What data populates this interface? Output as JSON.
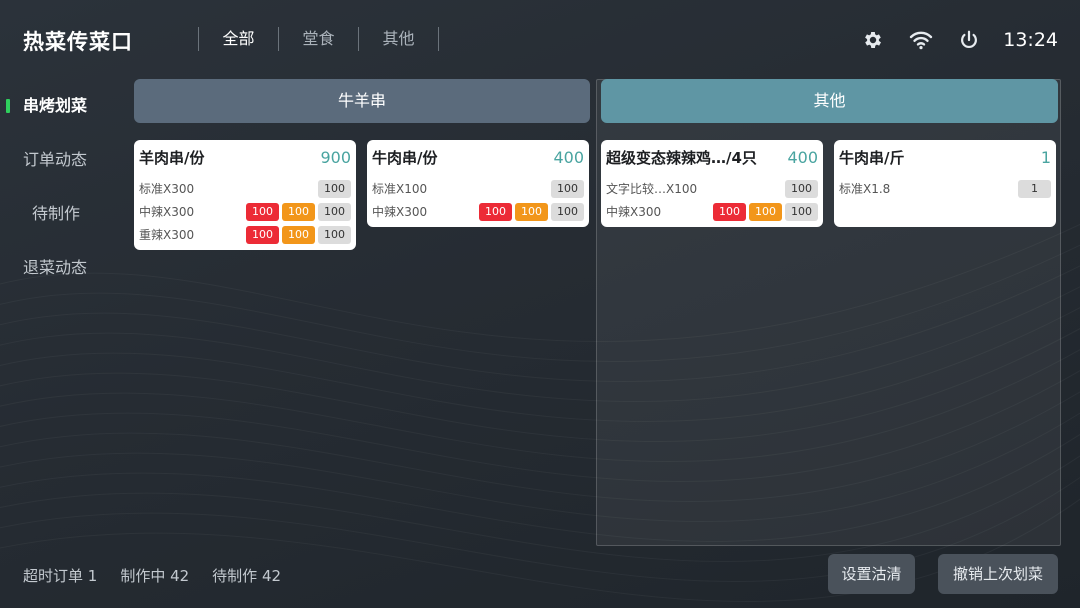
{
  "header": {
    "title": "热菜传菜口",
    "tabs": [
      {
        "label": "全部",
        "active": true
      },
      {
        "label": "堂食",
        "active": false
      },
      {
        "label": "其他",
        "active": false
      }
    ],
    "icons": [
      "gear-icon",
      "wifi-icon",
      "power-icon"
    ],
    "time": "13:24"
  },
  "sidebar": {
    "items": [
      {
        "label": "串烤划菜",
        "active": true
      },
      {
        "label": "订单动态",
        "active": false
      },
      {
        "label": "待制作",
        "active": false
      },
      {
        "label": "退菜动态",
        "active": false
      }
    ]
  },
  "panels": {
    "left_title": "牛羊串",
    "right_title": "其他"
  },
  "cards": [
    {
      "name": "羊肉串/份",
      "total": "900",
      "rows": [
        {
          "label": "标准X300",
          "badges": [
            {
              "v": "100",
              "c": "gray"
            }
          ]
        },
        {
          "label": "中辣X300",
          "badges": [
            {
              "v": "100",
              "c": "red"
            },
            {
              "v": "100",
              "c": "orange"
            },
            {
              "v": "100",
              "c": "gray"
            }
          ]
        },
        {
          "label": "重辣X300",
          "badges": [
            {
              "v": "100",
              "c": "red"
            },
            {
              "v": "100",
              "c": "orange"
            },
            {
              "v": "100",
              "c": "gray"
            }
          ]
        }
      ]
    },
    {
      "name": "牛肉串/份",
      "total": "400",
      "rows": [
        {
          "label": "标准X100",
          "badges": [
            {
              "v": "100",
              "c": "gray"
            }
          ]
        },
        {
          "label": "中辣X300",
          "badges": [
            {
              "v": "100",
              "c": "red"
            },
            {
              "v": "100",
              "c": "orange"
            },
            {
              "v": "100",
              "c": "gray"
            }
          ]
        }
      ]
    },
    {
      "name": "超级变态辣辣鸡…/4只",
      "total": "400",
      "rows": [
        {
          "label": "文字比较…X100",
          "badges": [
            {
              "v": "100",
              "c": "gray"
            }
          ]
        },
        {
          "label": "中辣X300",
          "badges": [
            {
              "v": "100",
              "c": "red"
            },
            {
              "v": "100",
              "c": "orange"
            },
            {
              "v": "100",
              "c": "gray"
            }
          ]
        }
      ]
    },
    {
      "name": "牛肉串/斤",
      "total": "1",
      "rows": [
        {
          "label": "标准X1.8",
          "badges": [
            {
              "v": "1",
              "c": "gray"
            }
          ]
        }
      ]
    }
  ],
  "footer": {
    "timeout": "超时订单 1",
    "in_progress": "制作中 42",
    "pending": "待制作 42",
    "clear_label": "设置沽清",
    "undo_label": "撤销上次划菜"
  },
  "colors": {
    "accent_green": "#2fcf5d",
    "panel_left": "#5b6b7c",
    "panel_right": "#5f96a4",
    "total_teal": "#49a4a0",
    "badge_red": "#ec2b36",
    "badge_orange": "#f2961a",
    "badge_gray": "#dcdcdc"
  }
}
